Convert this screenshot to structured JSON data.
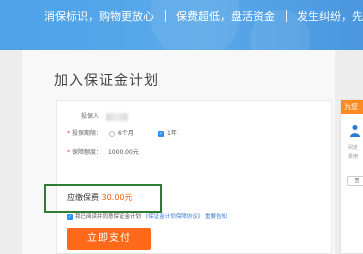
{
  "banner": {
    "slogans": [
      "消保标识，购物更放心",
      "保费超低，盘活资金",
      "发生纠纷，先行赔"
    ]
  },
  "page_title": "加入保证金计划",
  "form": {
    "insurer_label": "投保人",
    "period_label": "投保期限：",
    "period_options": [
      "6个月",
      "1年"
    ],
    "coverage_label": "保障额度：",
    "coverage_value": "1000.00元",
    "due_label": "应缴保费",
    "due_amount": "30.00元",
    "agree_text": "我已阅读并同意保证金计划",
    "agreement_link": "《保证金计划保障协议》",
    "notice_link": "重要告知",
    "pay_button": "立即支付"
  },
  "side": {
    "tag": "为您",
    "text_lines": [
      "闲定",
      "费用"
    ],
    "button": "查"
  },
  "colors": {
    "banner_blue": "#4ea2e8",
    "pay_orange": "#ff6a1a",
    "amount_orange": "#ff5a00",
    "highlight_green": "#2e7d32",
    "link_blue": "#3a7bd5"
  }
}
